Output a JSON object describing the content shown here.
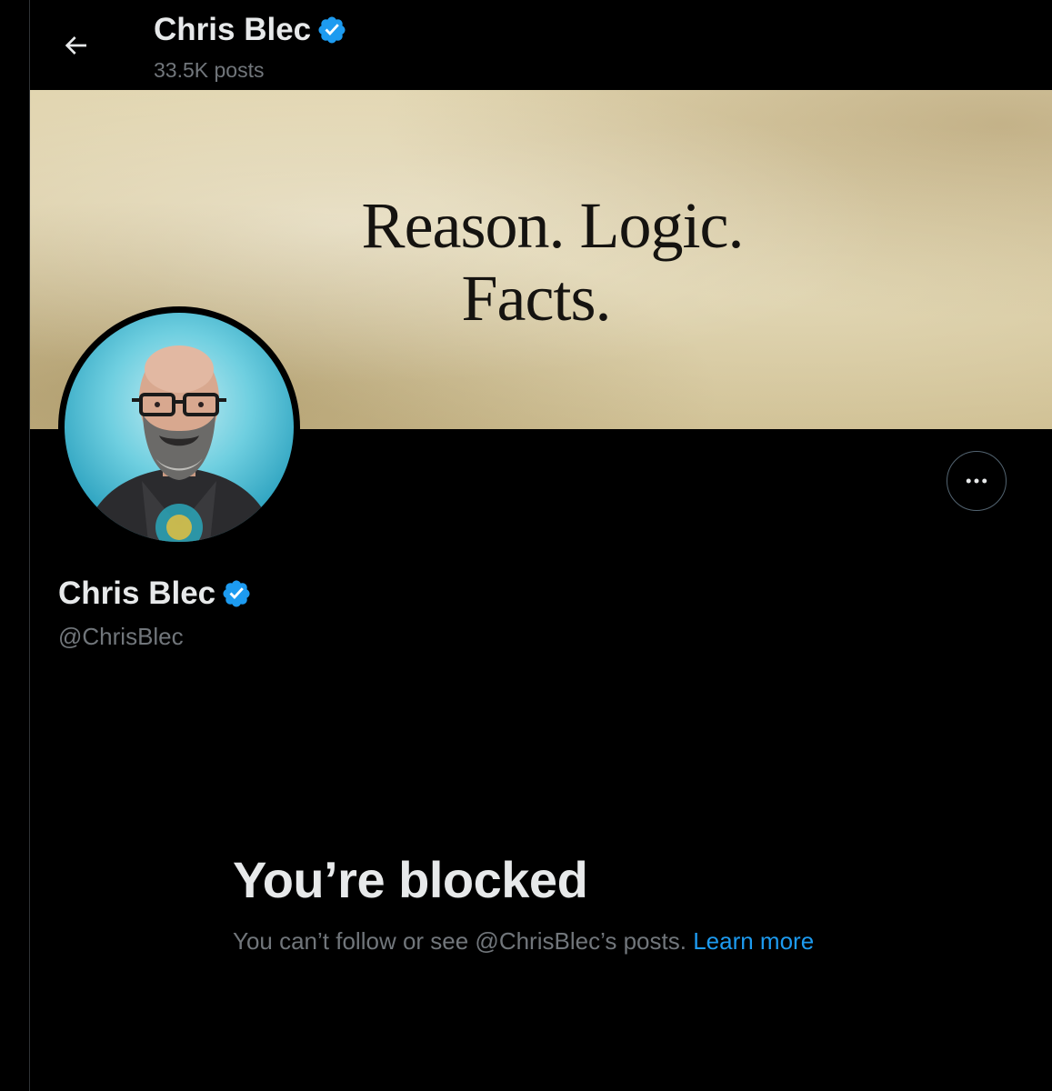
{
  "header": {
    "name": "Chris Blec",
    "post_count": "33.5K posts"
  },
  "banner": {
    "line1": "Reason.  Logic.",
    "line2": "Facts."
  },
  "profile": {
    "name": "Chris Blec",
    "handle": "@ChrisBlec",
    "verified": true
  },
  "blocked": {
    "title": "You’re blocked",
    "message": "You can’t follow or see @ChrisBlec’s posts.",
    "link_label": "Learn more"
  },
  "colors": {
    "background": "#000000",
    "primary_text": "#e7e9ea",
    "secondary_text": "#71767b",
    "accent_blue": "#1d9bf0",
    "banner_parchment": "#d9cba2"
  },
  "icons": {
    "back": "arrow-left-icon",
    "verified": "verified-badge-icon",
    "more": "more-horizontal-icon"
  }
}
